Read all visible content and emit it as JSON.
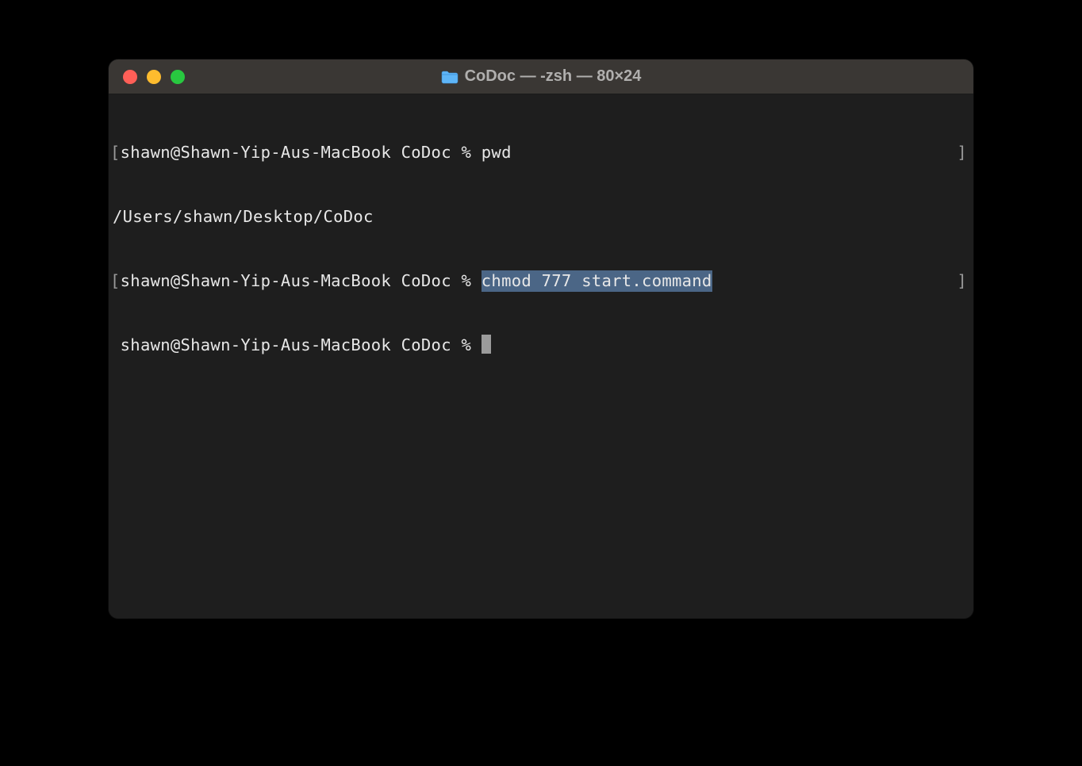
{
  "window": {
    "title": "CoDoc — -zsh — 80×24"
  },
  "terminal": {
    "lines": [
      {
        "bracket_left": "[",
        "prompt": "shawn@Shawn-Yip-Aus-MacBook CoDoc % ",
        "command": "pwd",
        "bracket_right": "]"
      },
      {
        "output": "/Users/shawn/Desktop/CoDoc"
      },
      {
        "bracket_left": "[",
        "prompt": "shawn@Shawn-Yip-Aus-MacBook CoDoc % ",
        "command_highlighted": "chmod 777 start.command",
        "bracket_right": "]"
      },
      {
        "space": " ",
        "prompt": "shawn@Shawn-Yip-Aus-MacBook CoDoc % ",
        "cursor": true
      }
    ]
  }
}
